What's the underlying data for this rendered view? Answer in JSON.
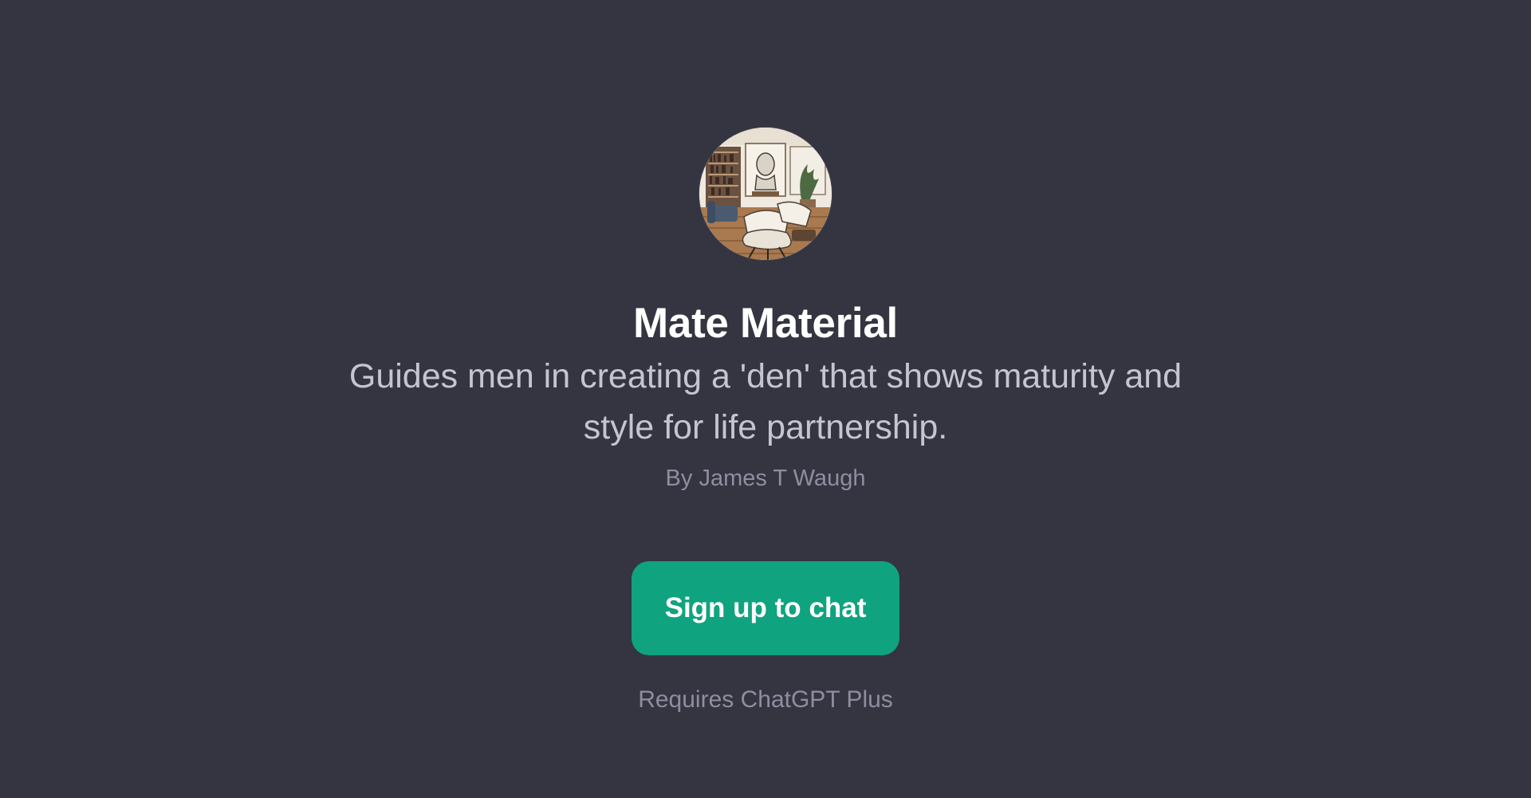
{
  "gpt": {
    "avatar_alt": "Mate Material",
    "name": "Mate Material",
    "description": "Guides men in creating a 'den' that shows maturity and style for life partnership.",
    "author": "By James T Waugh"
  },
  "cta": {
    "label": "Sign up to chat"
  },
  "footer": {
    "requirement": "Requires ChatGPT Plus"
  },
  "colors": {
    "background": "#343541",
    "title": "#ffffff",
    "description": "#c5c5d2",
    "muted": "#8e8ea0",
    "accent": "#10a37f"
  }
}
